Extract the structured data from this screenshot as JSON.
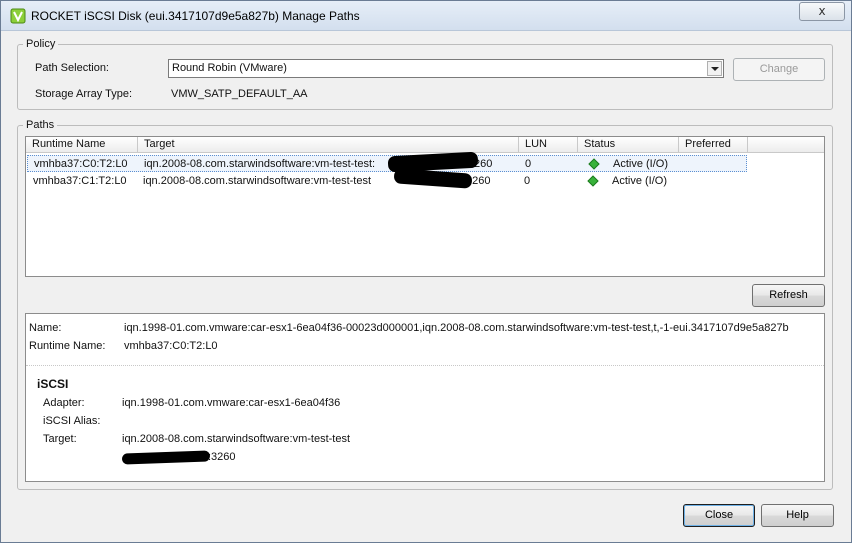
{
  "window": {
    "title": "ROCKET iSCSI Disk (eui.3417107d9e5a827b) Manage Paths",
    "close_glyph": "x"
  },
  "policy": {
    "legend": "Policy",
    "path_selection_label": "Path Selection:",
    "path_selection_value": "Round Robin (VMware)",
    "change_label": "Change",
    "storage_array_type_label": "Storage Array Type:",
    "storage_array_type_value": "VMW_SATP_DEFAULT_AA"
  },
  "paths": {
    "legend": "Paths",
    "columns": [
      "Runtime Name",
      "Target",
      "LUN",
      "Status",
      "Preferred"
    ],
    "rows": [
      {
        "runtime_name": "vmhba37:C0:T2:L0",
        "target_visible": "iqn.2008-08.com.starwindsoftware:vm-test-test:",
        "target_suffix": "260",
        "lun": "0",
        "status": "Active (I/O)",
        "status_color": "#38b23a"
      },
      {
        "runtime_name": "vmhba37:C1:T2:L0",
        "target_visible": "iqn.2008-08.com.starwindsoftware:vm-test-test",
        "target_suffix": "3260",
        "lun": "0",
        "status": "Active (I/O)",
        "status_color": "#38b23a"
      }
    ],
    "refresh_label": "Refresh"
  },
  "details": {
    "name_label": "Name:",
    "name_value": "iqn.1998-01.com.vmware:car-esx1-6ea04f36-00023d000001,iqn.2008-08.com.starwindsoftware:vm-test-test,t,-1-eui.3417107d9e5a827b",
    "runtime_name_label": "Runtime Name:",
    "runtime_name_value": "vmhba37:C0:T2:L0",
    "iscsi_heading": "iSCSI",
    "adapter_label": "Adapter:",
    "adapter_value": "iqn.1998-01.com.vmware:car-esx1-6ea04f36",
    "alias_label": "iSCSI Alias:",
    "alias_value": "",
    "target_label": "Target:",
    "target_value": "iqn.2008-08.com.starwindsoftware:vm-test-test",
    "target_address_suffix": ":3260"
  },
  "footer": {
    "close_label": "Close",
    "help_label": "Help"
  }
}
